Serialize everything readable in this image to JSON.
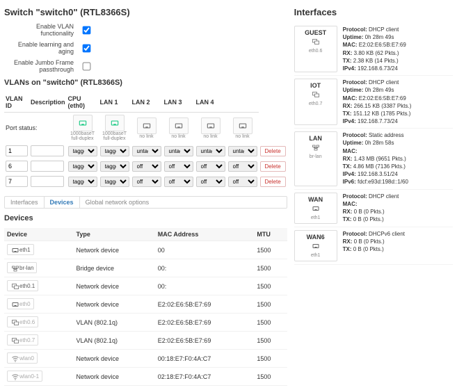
{
  "switch": {
    "title": "Switch \"switch0\" (RTL8366S)",
    "fields": {
      "enable_vlan": {
        "label": "Enable VLAN functionality",
        "checked": true
      },
      "enable_learning": {
        "label": "Enable learning and aging",
        "checked": true
      },
      "jumbo": {
        "label": "Enable Jumbo Frame passthrough",
        "checked": false
      }
    }
  },
  "vlans": {
    "title": "VLANs on \"switch0\" (RTL8366S)",
    "headers": [
      "VLAN ID",
      "Description",
      "CPU (eth0)",
      "LAN 1",
      "LAN 2",
      "LAN 3",
      "LAN 4",
      ""
    ],
    "port_status_label": "Port status:",
    "ports": [
      {
        "label": "1000baseT full-duplex",
        "link": true
      },
      {
        "label": "1000baseT full-duplex",
        "link": true
      },
      {
        "label": "no link",
        "link": false
      },
      {
        "label": "no link",
        "link": false
      },
      {
        "label": "no link",
        "link": false
      },
      {
        "label": "no link",
        "link": false
      }
    ],
    "rows": [
      {
        "id": "1",
        "desc": "",
        "cells": [
          "tagged",
          "tagged",
          "untagged",
          "untagged",
          "untagged",
          "untagged"
        ],
        "del": "Delete"
      },
      {
        "id": "6",
        "desc": "",
        "cells": [
          "tagged",
          "tagged",
          "off",
          "off",
          "off",
          "off"
        ],
        "del": "Delete"
      },
      {
        "id": "7",
        "desc": "",
        "cells": [
          "tagged",
          "tagged",
          "off",
          "off",
          "off",
          "off"
        ],
        "del": "Delete"
      }
    ]
  },
  "tabs": [
    "Interfaces",
    "Devices",
    "Global network options"
  ],
  "active_tab": "Devices",
  "devices_title": "Devices",
  "devices_headers": [
    "Device",
    "Type",
    "MAC Address",
    "MTU"
  ],
  "devices": [
    {
      "name": "eth1",
      "type": "Network device",
      "mac": "00",
      "mtu": "1500",
      "muted": false,
      "icon": "port"
    },
    {
      "name": "br-lan",
      "type": "Bridge device",
      "mac": "00:",
      "mtu": "1500",
      "muted": false,
      "icon": "bridge"
    },
    {
      "name": "eth0.1",
      "type": "Network device",
      "mac": "00:",
      "mtu": "1500",
      "muted": false,
      "icon": "vlan"
    },
    {
      "name": "eth0",
      "type": "Network device",
      "mac": "E2:02:E6:5B:E7:69",
      "mtu": "1500",
      "muted": true,
      "icon": "port"
    },
    {
      "name": "eth0.6",
      "type": "VLAN (802.1q)",
      "mac": "E2:02:E6:5B:E7:69",
      "mtu": "1500",
      "muted": true,
      "icon": "vlan"
    },
    {
      "name": "eth0.7",
      "type": "VLAN (802.1q)",
      "mac": "E2:02:E6:5B:E7:69",
      "mtu": "1500",
      "muted": true,
      "icon": "vlan"
    },
    {
      "name": "wlan0",
      "type": "Network device",
      "mac": "00:18:E7:F0:4A:C7",
      "mtu": "1500",
      "muted": true,
      "icon": "wifi"
    },
    {
      "name": "wlan0-1",
      "type": "Network device",
      "mac": "02:18:E7:F0:4A:C7",
      "mtu": "1500",
      "muted": true,
      "icon": "wifi"
    }
  ],
  "interfaces_title": "Interfaces",
  "interfaces": [
    {
      "name": "GUEST",
      "dev": "eth0.6",
      "icon": "vlan",
      "info": [
        [
          "Protocol:",
          "DHCP client"
        ],
        [
          "Uptime:",
          "0h 28m 49s"
        ],
        [
          "MAC:",
          "E2:02:E6:5B:E7:69"
        ],
        [
          "RX:",
          "3.80 KB (62 Pkts.)"
        ],
        [
          "TX:",
          "2.38 KB (14 Pkts.)"
        ],
        [
          "IPv4:",
          "192.168.6.73/24"
        ]
      ]
    },
    {
      "name": "IOT",
      "dev": "eth0.7",
      "icon": "vlan",
      "info": [
        [
          "Protocol:",
          "DHCP client"
        ],
        [
          "Uptime:",
          "0h 28m 49s"
        ],
        [
          "MAC:",
          "E2:02:E6:5B:E7:69"
        ],
        [
          "RX:",
          "266.15 KB (3387 Pkts.)"
        ],
        [
          "TX:",
          "151.12 KB (1785 Pkts.)"
        ],
        [
          "IPv4:",
          "192.168.7.73/24"
        ]
      ]
    },
    {
      "name": "LAN",
      "dev": "br-lan",
      "icon": "bridge",
      "info": [
        [
          "Protocol:",
          "Static address"
        ],
        [
          "Uptime:",
          "0h 28m 58s"
        ],
        [
          "MAC:",
          ""
        ],
        [
          "RX:",
          "1.43 MB (9651 Pkts.)"
        ],
        [
          "TX:",
          "4.86 MB (7136 Pkts.)"
        ],
        [
          "IPv4:",
          "192.168.3.51/24"
        ],
        [
          "IPv6:",
          "fdcf:e93d:198d::1/60"
        ]
      ]
    },
    {
      "name": "WAN",
      "dev": "eth1",
      "icon": "port",
      "info": [
        [
          "Protocol:",
          "DHCP client"
        ],
        [
          "MAC:",
          ""
        ],
        [
          "RX:",
          "0 B (0 Pkts.)"
        ],
        [
          "TX:",
          "0 B (0 Pkts.)"
        ]
      ]
    },
    {
      "name": "WAN6",
      "dev": "eth1",
      "icon": "port",
      "info": [
        [
          "Protocol:",
          "DHCPv6 client"
        ],
        [
          "RX:",
          "0 B (0 Pkts.)"
        ],
        [
          "TX:",
          "0 B (0 Pkts.)"
        ]
      ]
    }
  ]
}
